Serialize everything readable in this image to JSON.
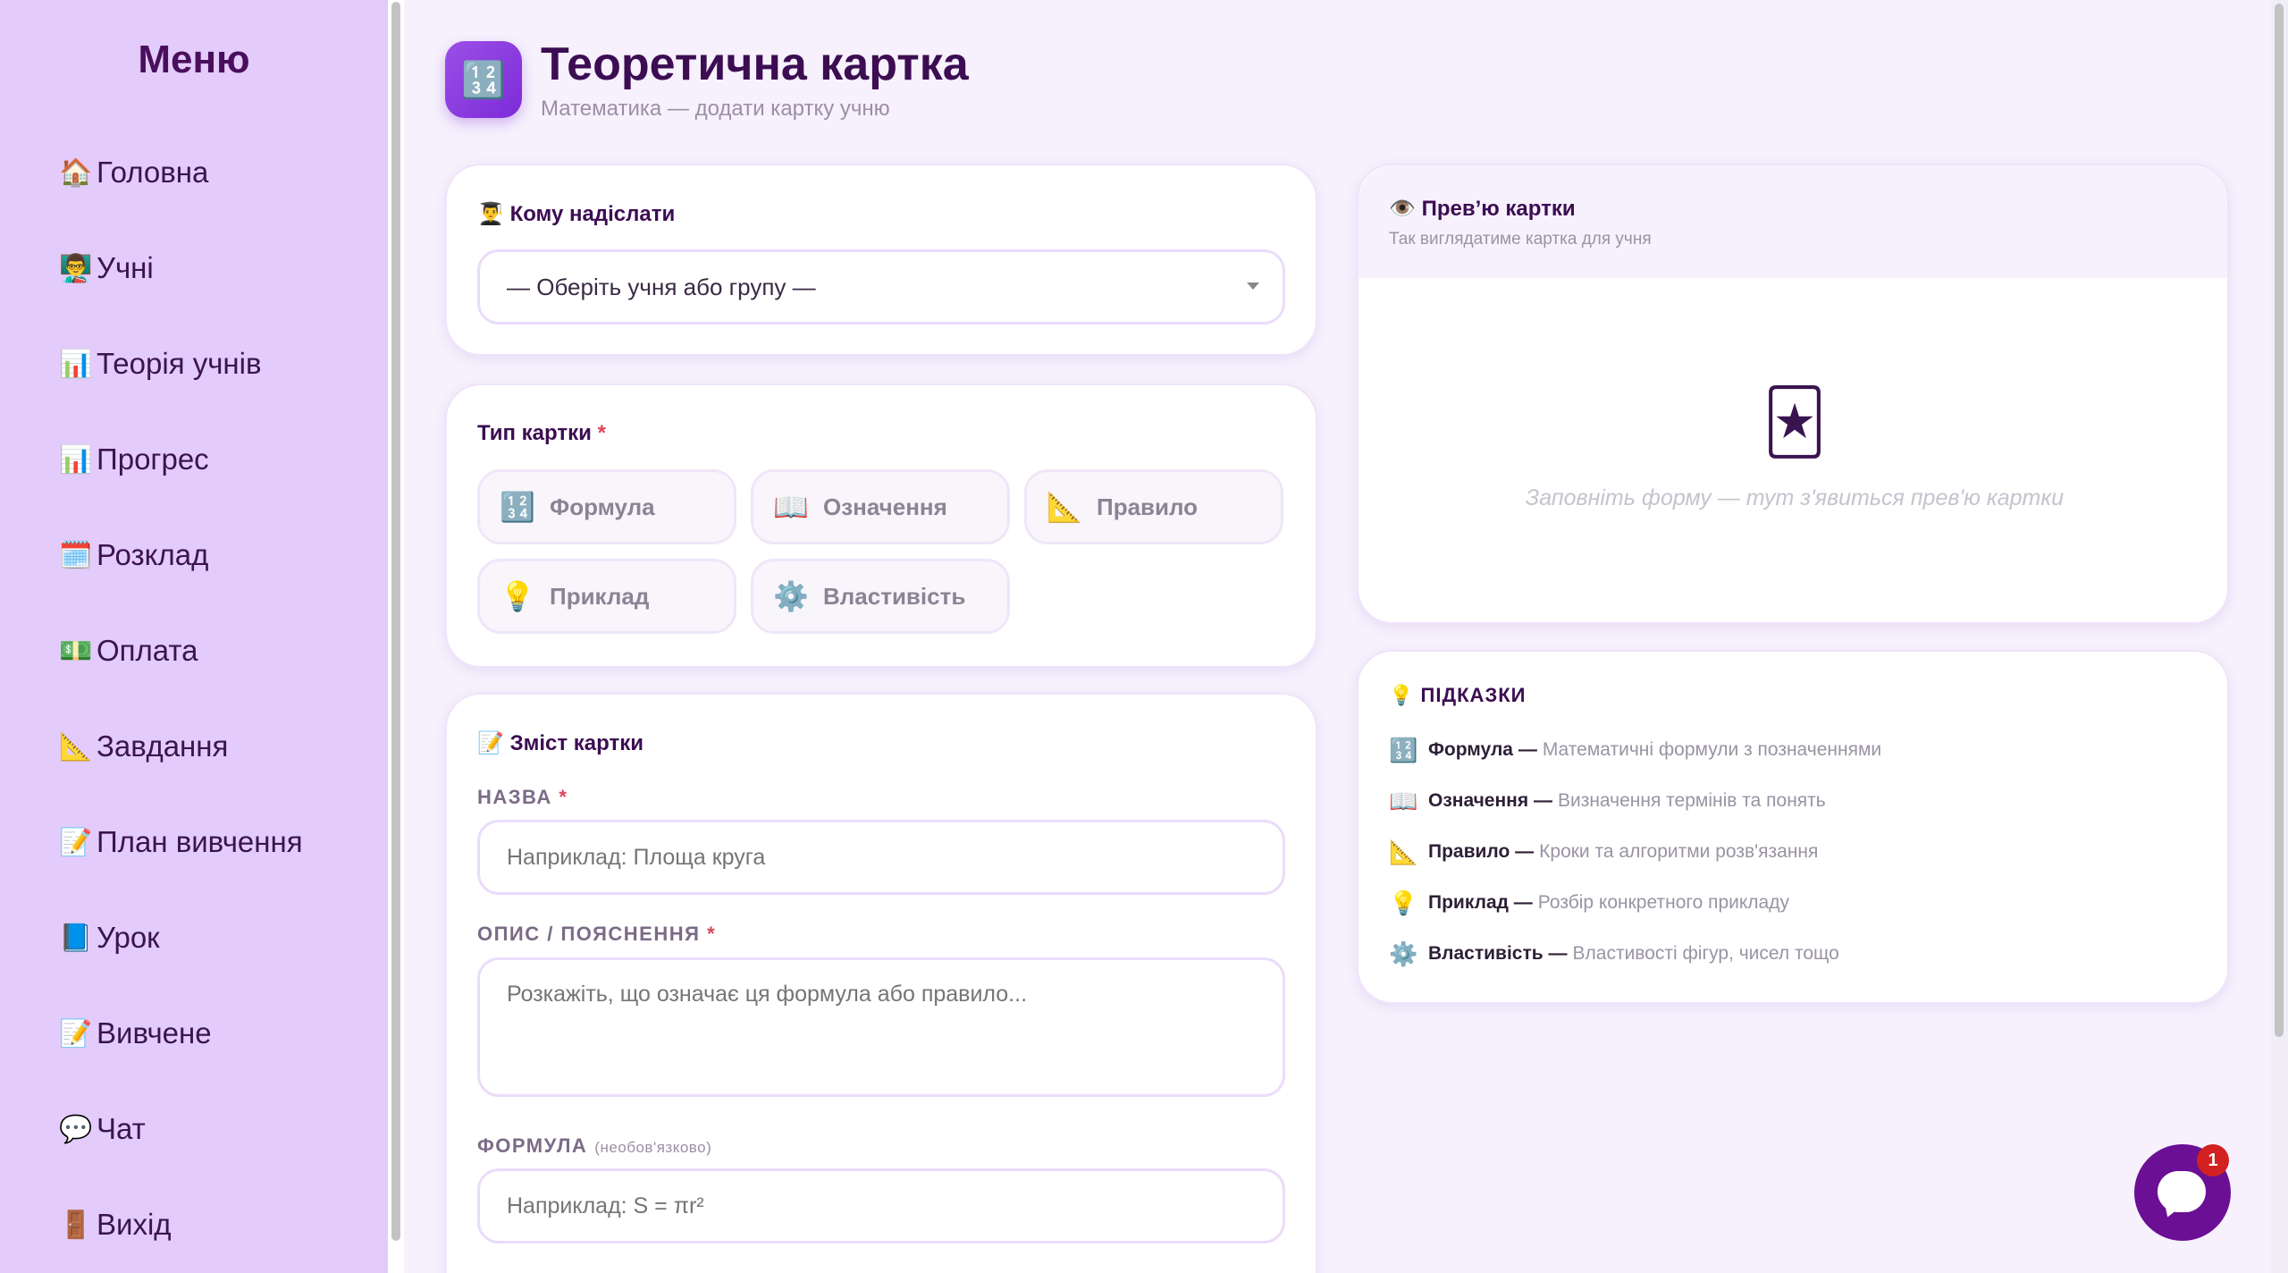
{
  "sidebar": {
    "title": "Меню",
    "items": [
      {
        "icon": "🏠",
        "icon_name": "home-icon",
        "label": "Головна"
      },
      {
        "icon": "👨‍🏫",
        "icon_name": "teacher-icon",
        "label": "Учні"
      },
      {
        "icon": "📊",
        "icon_name": "bar-chart-icon",
        "label": "Теорія учнів"
      },
      {
        "icon": "📊",
        "icon_name": "bar-chart-icon",
        "label": "Прогрес"
      },
      {
        "icon": "🗓️",
        "icon_name": "calendar-icon",
        "label": "Розклад"
      },
      {
        "icon": "💵",
        "icon_name": "money-icon",
        "label": "Оплата"
      },
      {
        "icon": "📐",
        "icon_name": "triangle-ruler-icon",
        "label": "Завдання"
      },
      {
        "icon": "📝",
        "icon_name": "memo-icon",
        "label": "План вивчення"
      },
      {
        "icon": "📘",
        "icon_name": "book-icon",
        "label": "Урок"
      },
      {
        "icon": "📝",
        "icon_name": "memo-icon",
        "label": "Вивчене"
      },
      {
        "icon": "💬",
        "icon_name": "speech-bubble-icon",
        "label": "Чат"
      },
      {
        "icon": "🚪",
        "icon_name": "door-icon",
        "label": "Вихід"
      }
    ]
  },
  "header": {
    "icon": "🔢",
    "title": "Теоретична картка",
    "subtitle": "Математика — додати картку учню"
  },
  "recipient": {
    "icon": "👨‍🎓",
    "title": "Кому надіслати",
    "select_value": "— Оберіть учня або групу —"
  },
  "card_type": {
    "title": "Тип картки",
    "required_mark": "*",
    "options": [
      {
        "icon": "🔢",
        "label": "Формула"
      },
      {
        "icon": "📖",
        "label": "Означення"
      },
      {
        "icon": "📐",
        "label": "Правило"
      },
      {
        "icon": "💡",
        "label": "Приклад"
      },
      {
        "icon": "⚙️",
        "label": "Властивість"
      }
    ]
  },
  "content": {
    "icon": "📝",
    "title": "Зміст картки",
    "name_label": "НАЗВА",
    "name_placeholder": "Наприклад: Площа круга",
    "desc_label": "ОПИС / ПОЯСНЕННЯ",
    "desc_placeholder": "Розкажіть, що означає ця формула або правило...",
    "formula_label": "ФОРМУЛА",
    "formula_optional": "(необов'язково)",
    "formula_placeholder": "Наприклад: S = πr²",
    "required_mark": "*"
  },
  "preview": {
    "icon": "👁️",
    "title": "Прев’ю картки",
    "subtitle": "Так виглядатиме картка для учня",
    "empty_icon": "🃏",
    "empty_text": "Заповніть форму — тут з'явиться прев'ю картки"
  },
  "hints": {
    "icon": "💡",
    "title": "ПІДКАЗКИ",
    "items": [
      {
        "icon": "🔢",
        "term": "Формула —",
        "desc": "Математичні формули з позначеннями"
      },
      {
        "icon": "📖",
        "term": "Означення —",
        "desc": "Визначення термінів та понять"
      },
      {
        "icon": "📐",
        "term": "Правило —",
        "desc": "Кроки та алгоритми розв'язання"
      },
      {
        "icon": "💡",
        "term": "Приклад —",
        "desc": "Розбір конкретного прикладу"
      },
      {
        "icon": "⚙️",
        "term": "Властивість —",
        "desc": "Властивості фігур, чисел тощо"
      }
    ]
  },
  "chat": {
    "badge": "1"
  },
  "colors": {
    "sidebar_bg": "#e3ccfb",
    "page_bg": "#f6f1fd",
    "accent": "#7d2bd8",
    "title": "#3c0d52",
    "chat_button": "#6b0f94",
    "badge": "#d32020",
    "required": "#d9455a"
  }
}
